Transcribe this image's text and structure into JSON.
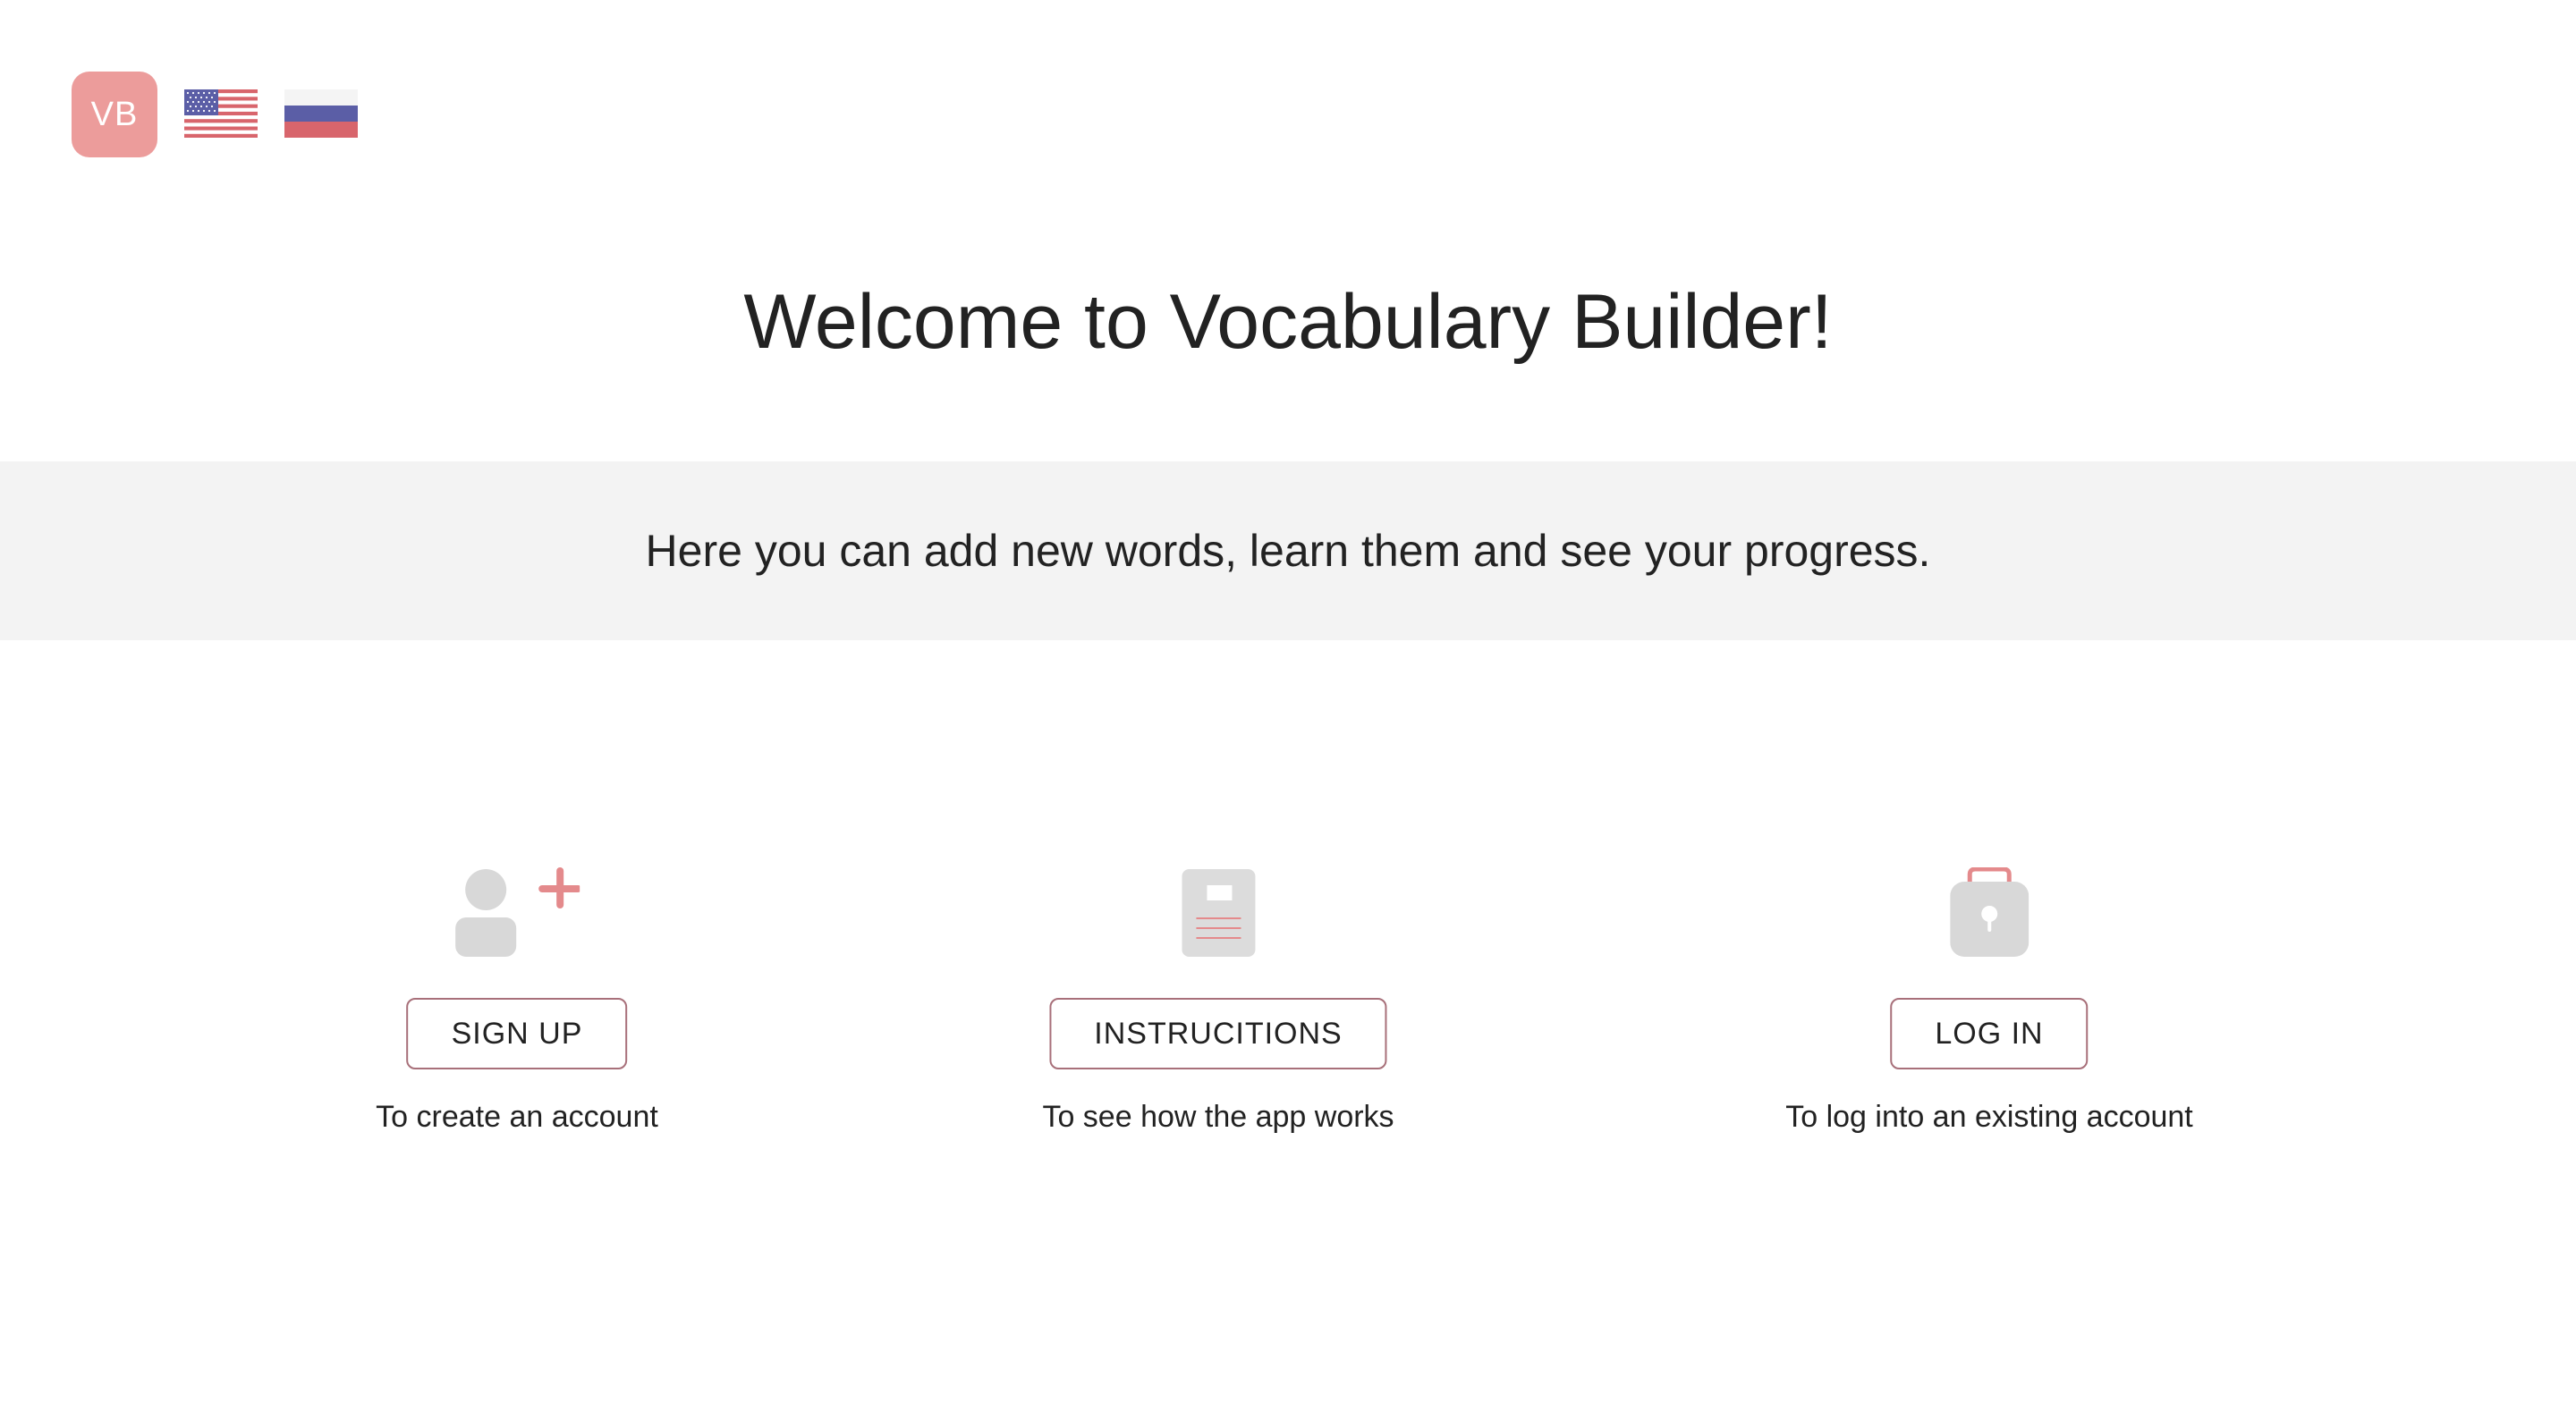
{
  "header": {
    "logo_text": "VB",
    "logo_color": "#ec9c9b",
    "languages": [
      {
        "code": "en",
        "icon": "us-flag-icon"
      },
      {
        "code": "ru",
        "icon": "russia-flag-icon"
      }
    ]
  },
  "main": {
    "title": "Welcome to Vocabulary Builder!",
    "subtitle": "Here you can add new words, learn them and see your progress."
  },
  "actions": {
    "signup": {
      "icon": "add-user-icon",
      "button_label": "SIGN UP",
      "caption": "To create an account"
    },
    "instructions": {
      "icon": "document-icon",
      "button_label": "INSTRUCITIONS",
      "caption": "To see how the app works"
    },
    "login": {
      "icon": "lock-icon",
      "button_label": "LOG IN",
      "caption": "To log into an existing account"
    }
  },
  "colors": {
    "accent": "#ec9c9b",
    "icon_gray": "#d8d8d8",
    "button_border": "#a8707a",
    "banner_bg": "#f3f3f3"
  }
}
